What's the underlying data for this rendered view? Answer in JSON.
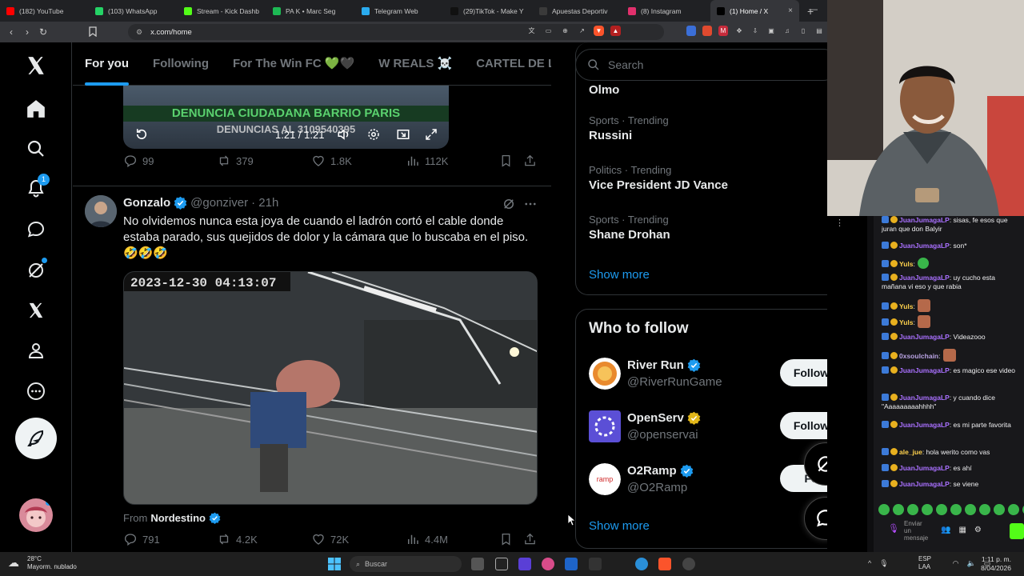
{
  "browser": {
    "tabs": [
      {
        "label": "(182) YouTube",
        "color": "#ff0000"
      },
      {
        "label": "(103) WhatsApp",
        "color": "#25d366"
      },
      {
        "label": "Stream - Kick Dashb",
        "color": "#53fc18"
      },
      {
        "label": "PA K • Marc Seg",
        "color": "#1db954"
      },
      {
        "label": "Telegram Web",
        "color": "#2aabee"
      },
      {
        "label": "(29)TikTok - Make Y",
        "color": "#111111"
      },
      {
        "label": "Apuestas Deportiv",
        "color": "#3a3a3a"
      },
      {
        "label": "(8) Instagram",
        "color": "#e1306c"
      },
      {
        "label": "(1) Home / X",
        "color": "#000000"
      }
    ],
    "url": "x.com/home",
    "new_tab": "+"
  },
  "nav": {
    "notifications_badge": "1"
  },
  "feed_tabs": [
    "For you",
    "Following",
    "For The Win FC 💚🖤",
    "W REALS ☠️",
    "CARTEL DE LO"
  ],
  "video1": {
    "banner": "DENUNCIA CIUDADANA BARRIO PARIS",
    "sub": "DENUNCIAS AL 3109540395",
    "time": "1:21 / 1:21"
  },
  "post1_actions": {
    "replies": "99",
    "reposts": "379",
    "likes": "1.8K",
    "views": "112K"
  },
  "post2": {
    "name": "Gonzalo",
    "handle": "@gonziver",
    "time": "· 21h",
    "text": "No olvidemos nunca esta joya de cuando el ladrón cortó el cable donde estaba parado, sus quejidos de dolor y la cámara que lo buscaba en el piso.",
    "emojis": "🤣🤣🤣",
    "video_timestamp": "2023-12-30  04:13:07",
    "from_label": "From",
    "from_name": "Nordestino",
    "actions": {
      "replies": "791",
      "reposts": "4.2K",
      "likes": "72K",
      "views": "4.4M"
    }
  },
  "search": {
    "placeholder": "Search"
  },
  "trends": [
    {
      "meta": "",
      "title": "Olmo"
    },
    {
      "meta": "Sports · Trending",
      "title": "Russini"
    },
    {
      "meta": "Politics · Trending",
      "title": "Vice President JD Vance"
    },
    {
      "meta": "Sports · Trending",
      "title": "Shane Drohan"
    }
  ],
  "show_more": "Show more",
  "who_to_follow": {
    "title": "Who to follow",
    "accounts": [
      {
        "name": "River Run",
        "handle": "@RiverRunGame",
        "badge_color": "#1d9bf0",
        "follow": "Follow"
      },
      {
        "name": "OpenServ",
        "handle": "@openservai",
        "badge_color": "#e2b719",
        "follow": "Follow"
      },
      {
        "name": "O2Ramp",
        "handle": "@O2Ramp",
        "badge_color": "#1d9bf0",
        "follow": "Fo"
      }
    ],
    "show_more": "Show more"
  },
  "chat": {
    "messages": [
      {
        "user": "JuanJumagaLP",
        "text": ": sisas, fe esos que juran que don Balyir"
      },
      {
        "user": "JuanJumagaLP",
        "text": ": son*"
      },
      {
        "user": "Yuls",
        "text": ":"
      },
      {
        "user": "JuanJumagaLP",
        "text": ": uy cucho esta mañana vi eso y que rabia"
      },
      {
        "user": "Yuls",
        "text": ":"
      },
      {
        "user": "Yuls",
        "text": ":"
      },
      {
        "user": "JuanJumagaLP",
        "text": ": Videazooo"
      },
      {
        "user": "0xsoulchain",
        "text": ":"
      },
      {
        "user": "JuanJumagaLP",
        "text": ": es magico ese video"
      },
      {
        "user": "JuanJumagaLP",
        "text": ": y cuando dice \"Aaaaaaaaahhhh\""
      },
      {
        "user": "JuanJumagaLP",
        "text": ": es mi parte favorita"
      },
      {
        "user": "ale_jue",
        "text": ": hola werito como vas"
      },
      {
        "user": "JuanJumagaLP",
        "text": ": es ahí"
      },
      {
        "user": "JuanJumagaLP",
        "text": ": se viene"
      }
    ],
    "input_placeholder": "Enviar un mensaje"
  },
  "taskbar": {
    "weather_temp": "28°C",
    "weather_desc": "Mayorm. nublado",
    "search": "Buscar",
    "lang": "ESP",
    "lang2": "LAA",
    "time": "1:11 p. m.",
    "date": "8/04/2026"
  }
}
